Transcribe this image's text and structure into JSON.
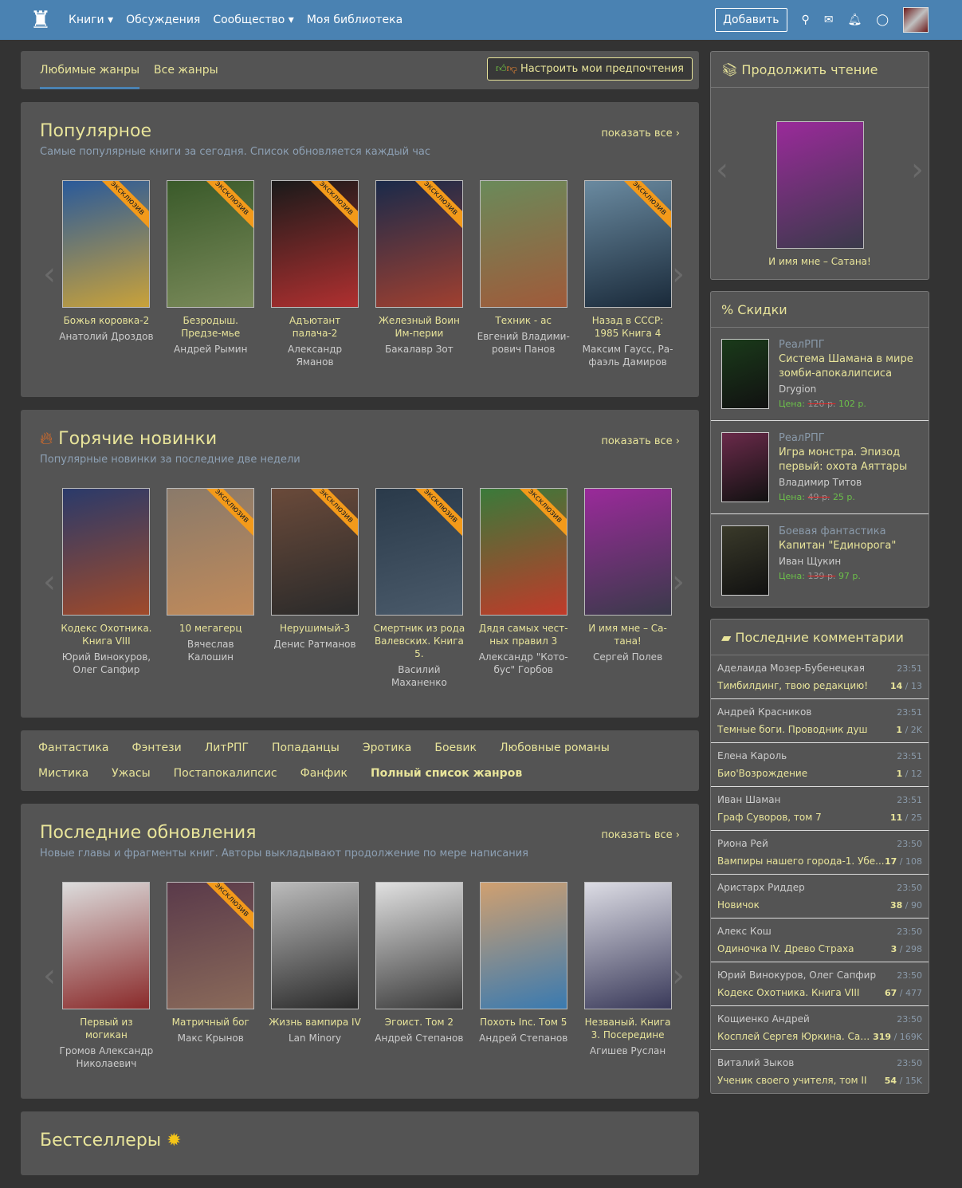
{
  "header": {
    "nav": [
      "Книги ▾",
      "Обсуждения",
      "Сообщество ▾",
      "Моя библиотека"
    ],
    "add": "Добавить"
  },
  "tabs": {
    "items": [
      "Любимые жанры",
      "Все жанры"
    ],
    "prefs": "Настроить мои предпочтения"
  },
  "ribbon": "эксклюзив",
  "sections": [
    {
      "title": "Популярное",
      "subtitle": "Самые популярные книги за сегодня. Список обновляется каждый час",
      "show_all": "показать все ›",
      "books": [
        {
          "title": "Божья коровка-2",
          "author": "Анатолий Дроздов",
          "ex": true,
          "c": [
            "#2a5a9a",
            "#c9a23a"
          ]
        },
        {
          "title": "Безродыш. Предзе-мье",
          "author": "Андрей Рымин",
          "ex": true,
          "c": [
            "#3a5a2a",
            "#7a8a5a"
          ]
        },
        {
          "title": "Адъютант палача-2",
          "author": "Александр Яманов",
          "ex": true,
          "c": [
            "#1a1a1a",
            "#b03030"
          ]
        },
        {
          "title": "Железный Воин Им-перии",
          "author": "Бакалавр Зот",
          "ex": true,
          "c": [
            "#1a2a4a",
            "#a04030"
          ]
        },
        {
          "title": "Техник - ас",
          "author": "Евгений Владими-рович Панов",
          "ex": false,
          "c": [
            "#6a8a5a",
            "#a05a3a"
          ]
        },
        {
          "title": "Назад в СССР: 1985 Книга 4",
          "author": "Максим Гаусс, Ра-фаэль Дамиров",
          "ex": true,
          "c": [
            "#6a8aa0",
            "#1a2a3a"
          ]
        }
      ]
    },
    {
      "title": "Горячие новинки",
      "subtitle": "Популярные новинки за последние две недели",
      "show_all": "показать все ›",
      "books": [
        {
          "title": "Кодекс Охотника. Книга VIII",
          "author": "Юрий Винокуров, Олег Сапфир",
          "ex": false,
          "c": [
            "#2a3a6a",
            "#a04a2a"
          ]
        },
        {
          "title": "10 мегагерц",
          "author": "Вячеслав Калошин",
          "ex": true,
          "c": [
            "#8a7a6a",
            "#c08a5a"
          ]
        },
        {
          "title": "Нерушимый-3",
          "author": "Денис Ратманов",
          "ex": true,
          "c": [
            "#6a4a3a",
            "#2a2a2a"
          ]
        },
        {
          "title": "Смертник из рода Валевских. Книга 5.",
          "author": "Василий Маханенко",
          "ex": true,
          "c": [
            "#2a3a4a",
            "#4a5a6a"
          ]
        },
        {
          "title": "Дядя самых чест-ных правил 3",
          "author": "Александр \"Кото-бус\" Горбов",
          "ex": true,
          "c": [
            "#3a7a3a",
            "#c03a2a"
          ]
        },
        {
          "title": "И имя мне – Са-тана!",
          "author": "Сергей Полев",
          "ex": false,
          "c": [
            "#9a2a9a",
            "#3a3a4a"
          ]
        }
      ]
    },
    {
      "title": "Последние обновления",
      "subtitle": "Новые главы и фрагменты книг. Авторы выкладывают продолжение по мере написания",
      "show_all": "показать все ›",
      "books": [
        {
          "title": "Первый из могикан",
          "author": "Громов Александр Николаевич",
          "ex": false,
          "c": [
            "#dcdcdc",
            "#8a2a2a"
          ]
        },
        {
          "title": "Матричный бог",
          "author": "Макс Крынов",
          "ex": true,
          "c": [
            "#5a3a4a",
            "#8a6a5a"
          ]
        },
        {
          "title": "Жизнь вампира IV",
          "author": "Lan Minory",
          "ex": false,
          "c": [
            "#bbbbbb",
            "#2a2a2a"
          ]
        },
        {
          "title": "Эгоист. Том 2",
          "author": "Андрей Степанов",
          "ex": false,
          "c": [
            "#e0e0e0",
            "#3a3a3a"
          ]
        },
        {
          "title": "Похоть Inc. Том 5",
          "author": "Андрей Степанов",
          "ex": false,
          "c": [
            "#d0a070",
            "#3a7ab0"
          ]
        },
        {
          "title": "Незваный. Книга 3. Посередине",
          "author": "Агишев Руслан",
          "ex": false,
          "c": [
            "#dcdce4",
            "#3a3a5a"
          ]
        }
      ]
    }
  ],
  "genres": [
    "Фантастика",
    "Фэнтези",
    "ЛитРПГ",
    "Попаданцы",
    "Эротика",
    "Боевик",
    "Любовные романы",
    "Мистика",
    "Ужасы",
    "Постапокалипсис",
    "Фанфик",
    "Полный список жанров"
  ],
  "bestsellers": "Бестселлеры",
  "continue": {
    "title": "Продолжить чтение",
    "book": "И имя мне – Сатана!"
  },
  "discounts": {
    "title": "% Скидки",
    "price_label": "Цена:",
    "items": [
      {
        "genre": "РеалРПГ",
        "title": "Система Шамана в мире зомби-апокалипсиса",
        "author": "Drygion",
        "old": "120 р.",
        "new": "102 р."
      },
      {
        "genre": "РеалРПГ",
        "title": "Игра монстра. Эпизод первый: охота Аяттары",
        "author": "Владимир Титов",
        "old": "49 р.",
        "new": "25 р."
      },
      {
        "genre": "Боевая фантастика",
        "title": "Капитан \"Единорога\"",
        "author": "Иван Щукин",
        "old": "139 р.",
        "new": "97 р."
      }
    ]
  },
  "comments": {
    "title": "Последние комментарии",
    "items": [
      {
        "user": "Аделаида Мозер-Бубенецкая",
        "time": "23:51",
        "book": "Тимбилдинг, твою редакцию!",
        "n": "14",
        "t": "13"
      },
      {
        "user": "Андрей Красников",
        "time": "23:51",
        "book": "Темные боги. Проводник душ",
        "n": "1",
        "t": "2K"
      },
      {
        "user": "Елена Кароль",
        "time": "23:51",
        "book": "Био'Возрождение",
        "n": "1",
        "t": "12"
      },
      {
        "user": "Иван Шаман",
        "time": "23:51",
        "book": "Граф Суворов, том 7",
        "n": "11",
        "t": "25"
      },
      {
        "user": "Риона Рей",
        "time": "23:50",
        "book": "Вампиры нашего города-1. Убе...",
        "n": "17",
        "t": "108"
      },
      {
        "user": "Аристарх Риддер",
        "time": "23:50",
        "book": "Новичок",
        "n": "38",
        "t": "90"
      },
      {
        "user": "Алекс Кош",
        "time": "23:50",
        "book": "Одиночка IV. Древо Страха",
        "n": "3",
        "t": "298"
      },
      {
        "user": "Юрий Винокуров, Олег Сапфир",
        "time": "23:50",
        "book": "Кодекс Охотника. Книга VIII",
        "n": "67",
        "t": "477"
      },
      {
        "user": "Кощиенко Андрей",
        "time": "23:50",
        "book": "Косплей Сергея Юркина. Сакур...",
        "n": "319",
        "t": "169K"
      },
      {
        "user": "Виталий Зыков",
        "time": "23:50",
        "book": "Ученик своего учителя, том II",
        "n": "54",
        "t": "15K"
      }
    ]
  }
}
